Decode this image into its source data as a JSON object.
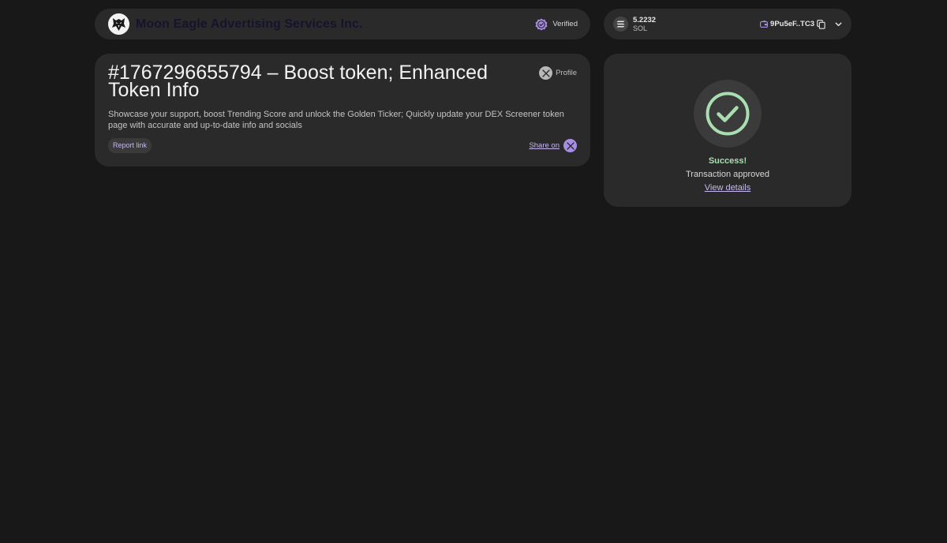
{
  "merchant": {
    "name": "Moon Eagle Advertising Services Inc.",
    "logo_icon": "eagle-logo-icon",
    "verified_label": "Verified",
    "verified_icon": "verified-badge-icon"
  },
  "wallet": {
    "balance": "5.2232",
    "currency": "SOL",
    "currency_icon": "solana-icon",
    "address": "9Pu5eF..TC3",
    "address_icon": "wallet-icon",
    "copy_icon": "copy-icon",
    "menu_icon": "chevron-down-icon"
  },
  "product": {
    "title": "#1767296655794 – Boost token; Enhanced Token Info",
    "description": "Showcase your support, boost Trending Score and unlock the Golden Ticker; Quickly update your DEX Screener token page with accurate and up-to-date info and socials",
    "profile_label": "Profile",
    "profile_icon": "x-logo-icon",
    "report_label": "Report link",
    "share_label": "Share on",
    "share_icon": "x-logo-icon"
  },
  "status": {
    "title": "Success!",
    "message": "Transaction approved",
    "details_link": "View details",
    "icon": "check-circle-icon"
  },
  "colors": {
    "background": "#181818",
    "card": "#2a2a2a",
    "accent": "#a68de6",
    "success": "#a9dfb0"
  }
}
